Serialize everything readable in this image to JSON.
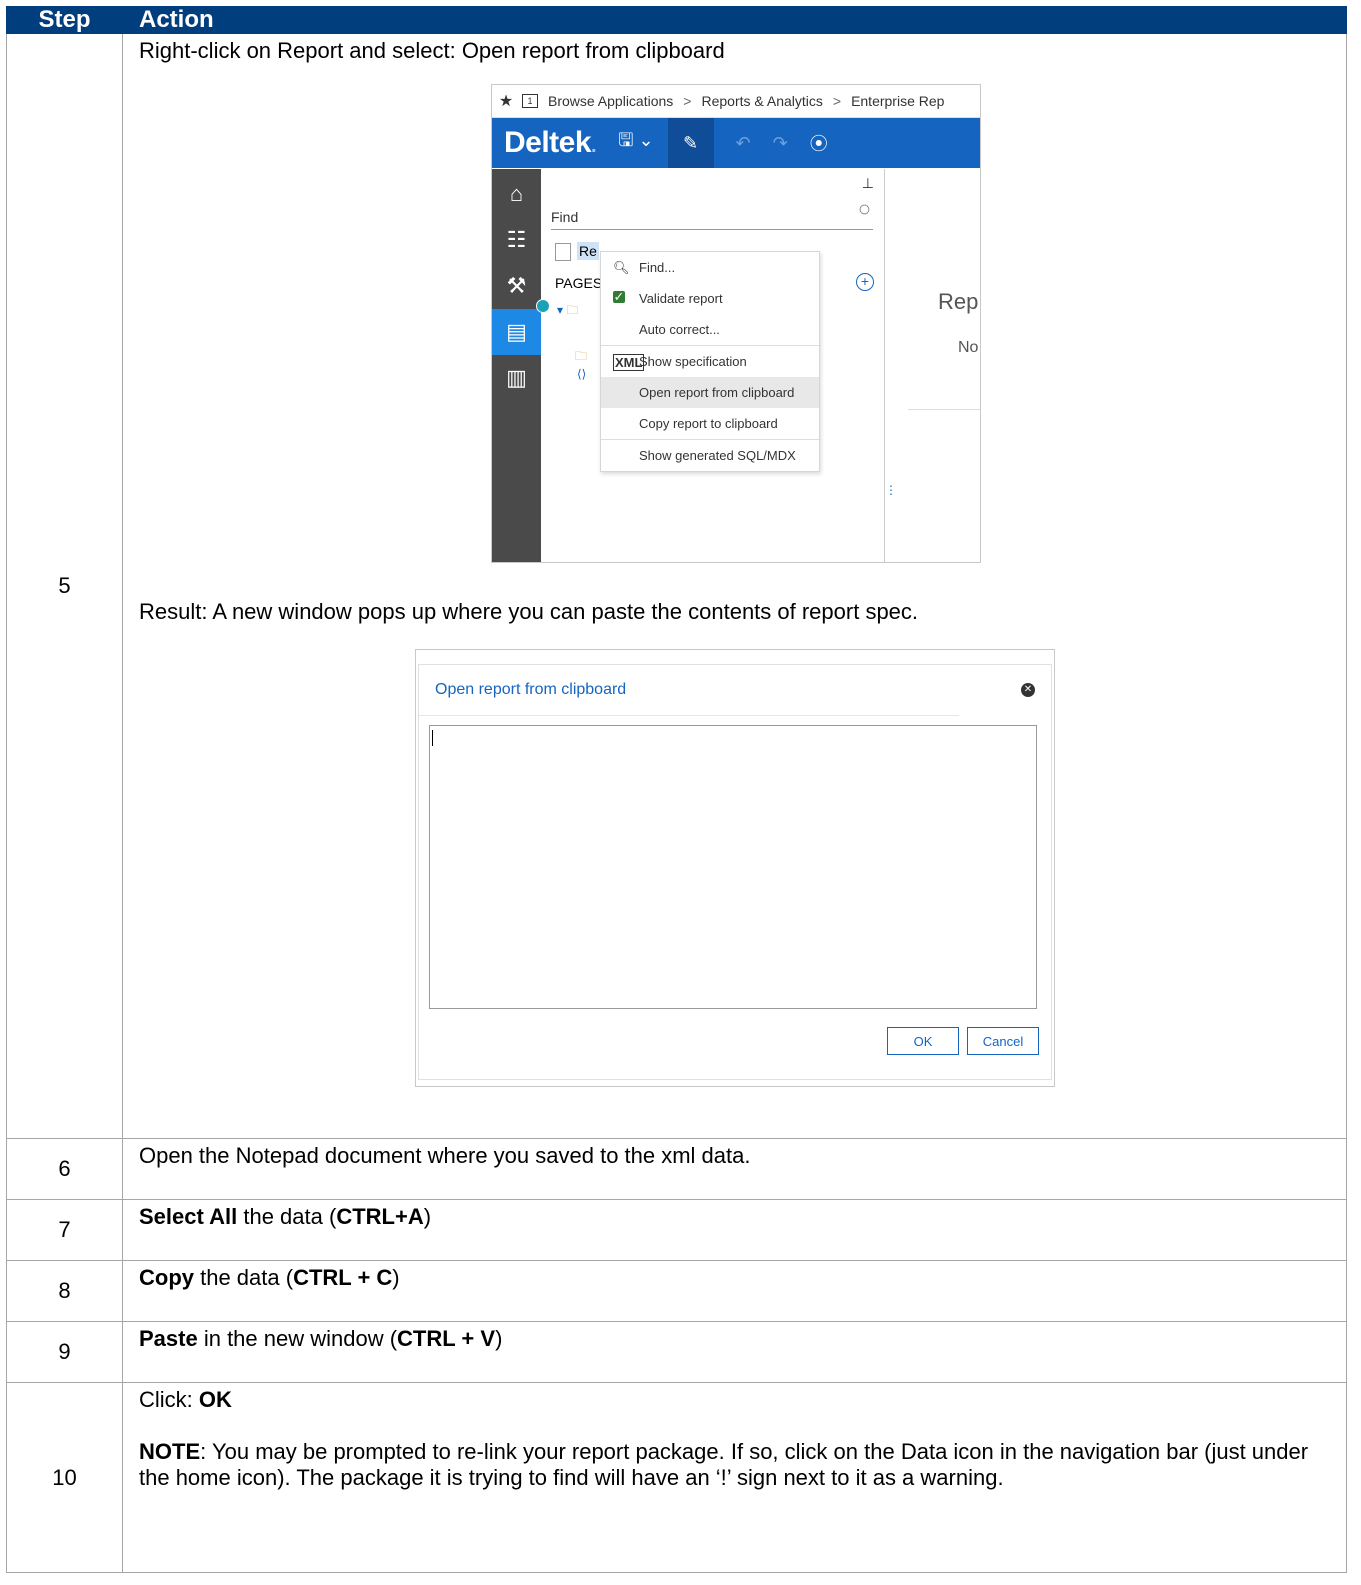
{
  "table": {
    "header": {
      "step": "Step",
      "action": "Action"
    }
  },
  "step5": {
    "number": "5",
    "instruction": "Right-click on Report and select: Open report from clipboard",
    "result": "Result: A new window pops up where you can paste the contents of report spec.",
    "screenshot1": {
      "breadcrumb": [
        "Browse Applications",
        "Reports & Analytics",
        "Enterprise Rep"
      ],
      "breadcrumb_sep": ">",
      "logo": "Deltek",
      "find_placeholder": "Find",
      "report_label": "Re",
      "pages_label": "PAGES",
      "context_menu": [
        {
          "label": "Find...",
          "icon": "search-icon"
        },
        {
          "label": "Validate report",
          "icon": "check-icon"
        },
        {
          "label": "Auto correct...",
          "icon": ""
        },
        {
          "label": "Show specification",
          "icon": "xml-icon"
        },
        {
          "label": "Open report from clipboard",
          "icon": ""
        },
        {
          "label": "Copy report to clipboard",
          "icon": ""
        },
        {
          "label": "Show generated SQL/MDX",
          "icon": ""
        }
      ],
      "right_text1": "Rep",
      "right_text2": "No",
      "colors": {
        "brand_blue": "#1565c0",
        "sidebar": "#4a4a4a",
        "active": "#1e88e5"
      }
    },
    "screenshot2": {
      "title": "Open report from clipboard",
      "ok": "OK",
      "cancel": "Cancel"
    }
  },
  "step6": {
    "number": "6",
    "text": "Open the Notepad document where you saved to the xml data."
  },
  "step7": {
    "number": "7",
    "bold1": "Select All",
    "text1": " the data (",
    "bold2": "CTRL+A",
    "text2": ")"
  },
  "step8": {
    "number": "8",
    "bold1": "Copy",
    "text1": " the data (",
    "bold2": "CTRL + C",
    "text2": ")"
  },
  "step9": {
    "number": "9",
    "bold1": "Paste",
    "text1": " in the new window (",
    "bold2": "CTRL + V",
    "text2": ")"
  },
  "step10": {
    "number": "10",
    "click_prefix": "Click: ",
    "click_bold": "OK",
    "note_bold": "NOTE",
    "note_text": ": You may be prompted to re-link your report package. If so, click on the Data icon in the navigation bar (just under the home icon).  The package it is trying to find will have an ‘!’ sign next to it as a warning."
  }
}
